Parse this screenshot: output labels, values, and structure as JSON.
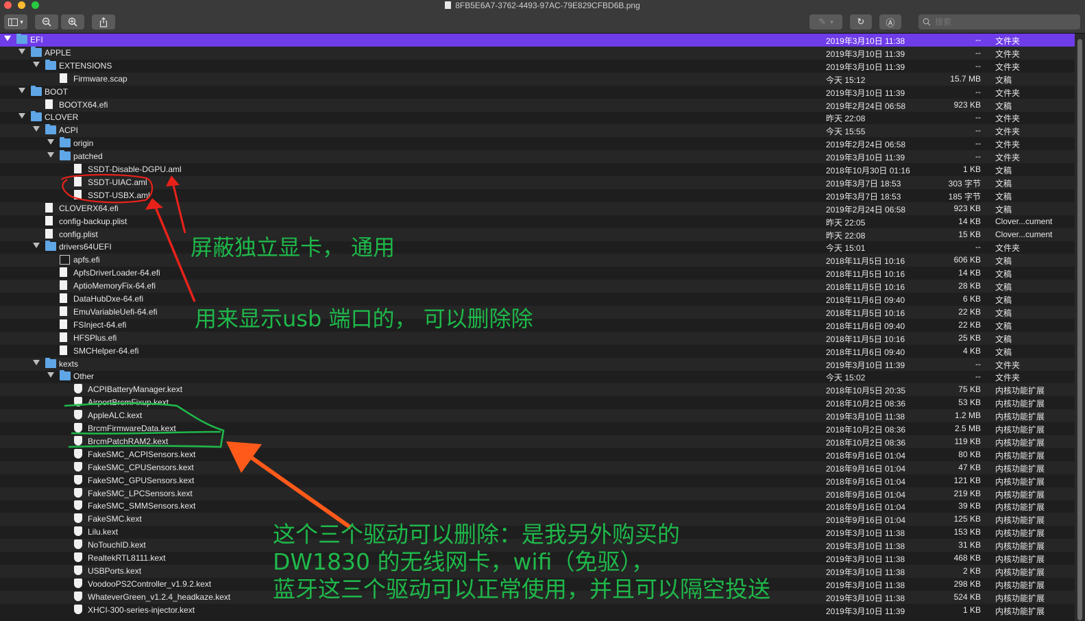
{
  "window": {
    "title": "8FB5E6A7-3762-4493-97AC-79E829CFBD6B.png",
    "lights": [
      "#ff5f57",
      "#febc2e",
      "#28c840"
    ]
  },
  "toolbar": {
    "sidebar_icon": "sidebar-icon",
    "chevron": "▾",
    "zoom_out": "⊖",
    "zoom_in": "⊕",
    "share": "⇪",
    "markup": "✎",
    "rotate": "↻",
    "annotate": "Ⓐ",
    "search_placeholder": "搜索"
  },
  "colors": {
    "selection": "#6e3ce8",
    "folder": "#5fa6e6",
    "annotation_green": "#1fb84a",
    "annotation_red": "#e8221a",
    "annotation_orange": "#ff5a1a"
  },
  "rows": [
    {
      "name": "EFI",
      "depth": 0,
      "type": "folder",
      "expanded": true,
      "date": "2019年3月10日 11:38",
      "size": "--",
      "kind": "文件夹",
      "selected": true
    },
    {
      "name": "APPLE",
      "depth": 1,
      "type": "folder",
      "expanded": true,
      "date": "2019年3月10日 11:39",
      "size": "--",
      "kind": "文件夹"
    },
    {
      "name": "EXTENSIONS",
      "depth": 2,
      "type": "folder",
      "expanded": true,
      "date": "2019年3月10日 11:39",
      "size": "--",
      "kind": "文件夹"
    },
    {
      "name": "Firmware.scap",
      "depth": 3,
      "type": "file",
      "date": "今天 15:12",
      "size": "15.7 MB",
      "kind": "文稿"
    },
    {
      "name": "BOOT",
      "depth": 1,
      "type": "folder",
      "expanded": true,
      "date": "2019年3月10日 11:39",
      "size": "--",
      "kind": "文件夹"
    },
    {
      "name": "BOOTX64.efi",
      "depth": 2,
      "type": "file",
      "date": "2019年2月24日 06:58",
      "size": "923 KB",
      "kind": "文稿"
    },
    {
      "name": "CLOVER",
      "depth": 1,
      "type": "folder",
      "expanded": true,
      "date": "昨天 22:08",
      "size": "--",
      "kind": "文件夹"
    },
    {
      "name": "ACPI",
      "depth": 2,
      "type": "folder",
      "expanded": true,
      "date": "今天 15:55",
      "size": "--",
      "kind": "文件夹"
    },
    {
      "name": "origin",
      "depth": 3,
      "type": "folder",
      "expanded": true,
      "date": "2019年2月24日 06:58",
      "size": "--",
      "kind": "文件夹"
    },
    {
      "name": "patched",
      "depth": 3,
      "type": "folder",
      "expanded": true,
      "date": "2019年3月10日 11:39",
      "size": "--",
      "kind": "文件夹"
    },
    {
      "name": "SSDT-Disable-DGPU.aml",
      "depth": 4,
      "type": "file",
      "date": "2018年10月30日 01:16",
      "size": "1 KB",
      "kind": "文稿"
    },
    {
      "name": "SSDT-UIAC.aml",
      "depth": 4,
      "type": "file",
      "date": "2019年3月7日 18:53",
      "size": "303 字节",
      "kind": "文稿"
    },
    {
      "name": "SSDT-USBX.aml",
      "depth": 4,
      "type": "file",
      "date": "2019年3月7日 18:53",
      "size": "185 字节",
      "kind": "文稿"
    },
    {
      "name": "CLOVERX64.efi",
      "depth": 2,
      "type": "file",
      "date": "2019年2月24日 06:58",
      "size": "923 KB",
      "kind": "文稿"
    },
    {
      "name": "config-backup.plist",
      "depth": 2,
      "type": "file",
      "date": "昨天 22:05",
      "size": "14 KB",
      "kind": "Clover...cument"
    },
    {
      "name": "config.plist",
      "depth": 2,
      "type": "file",
      "date": "昨天 22:08",
      "size": "15 KB",
      "kind": "Clover...cument"
    },
    {
      "name": "drivers64UEFI",
      "depth": 2,
      "type": "folder",
      "expanded": true,
      "date": "今天 15:01",
      "size": "--",
      "kind": "文件夹"
    },
    {
      "name": "apfs.efi",
      "depth": 3,
      "type": "efi",
      "date": "2018年11月5日 10:16",
      "size": "606 KB",
      "kind": "文稿"
    },
    {
      "name": "ApfsDriverLoader-64.efi",
      "depth": 3,
      "type": "file",
      "date": "2018年11月5日 10:16",
      "size": "14 KB",
      "kind": "文稿"
    },
    {
      "name": "AptioMemoryFix-64.efi",
      "depth": 3,
      "type": "file",
      "date": "2018年11月5日 10:16",
      "size": "28 KB",
      "kind": "文稿"
    },
    {
      "name": "DataHubDxe-64.efi",
      "depth": 3,
      "type": "file",
      "date": "2018年11月6日 09:40",
      "size": "6 KB",
      "kind": "文稿"
    },
    {
      "name": "EmuVariableUefi-64.efi",
      "depth": 3,
      "type": "file",
      "date": "2018年11月5日 10:16",
      "size": "22 KB",
      "kind": "文稿"
    },
    {
      "name": "FSInject-64.efi",
      "depth": 3,
      "type": "file",
      "date": "2018年11月6日 09:40",
      "size": "22 KB",
      "kind": "文稿"
    },
    {
      "name": "HFSPlus.efi",
      "depth": 3,
      "type": "file",
      "date": "2018年11月5日 10:16",
      "size": "25 KB",
      "kind": "文稿"
    },
    {
      "name": "SMCHelper-64.efi",
      "depth": 3,
      "type": "file",
      "date": "2018年11月6日 09:40",
      "size": "4 KB",
      "kind": "文稿"
    },
    {
      "name": "kexts",
      "depth": 2,
      "type": "folder",
      "expanded": true,
      "date": "2019年3月10日 11:39",
      "size": "--",
      "kind": "文件夹"
    },
    {
      "name": "Other",
      "depth": 3,
      "type": "folder",
      "expanded": true,
      "date": "今天 15:02",
      "size": "--",
      "kind": "文件夹"
    },
    {
      "name": "ACPIBatteryManager.kext",
      "depth": 4,
      "type": "kext",
      "date": "2018年10月5日 20:35",
      "size": "75 KB",
      "kind": "内核功能扩展"
    },
    {
      "name": "AirportBrcmFixup.kext",
      "depth": 4,
      "type": "kext",
      "date": "2018年10月2日 08:36",
      "size": "53 KB",
      "kind": "内核功能扩展"
    },
    {
      "name": "AppleALC.kext",
      "depth": 4,
      "type": "kext",
      "date": "2019年3月10日 11:38",
      "size": "1.2 MB",
      "kind": "内核功能扩展"
    },
    {
      "name": "BrcmFirmwareData.kext",
      "depth": 4,
      "type": "kext",
      "date": "2018年10月2日 08:36",
      "size": "2.5 MB",
      "kind": "内核功能扩展"
    },
    {
      "name": "BrcmPatchRAM2.kext",
      "depth": 4,
      "type": "kext",
      "date": "2018年10月2日 08:36",
      "size": "119 KB",
      "kind": "内核功能扩展"
    },
    {
      "name": "FakeSMC_ACPISensors.kext",
      "depth": 4,
      "type": "kext",
      "date": "2018年9月16日 01:04",
      "size": "80 KB",
      "kind": "内核功能扩展"
    },
    {
      "name": "FakeSMC_CPUSensors.kext",
      "depth": 4,
      "type": "kext",
      "date": "2018年9月16日 01:04",
      "size": "47 KB",
      "kind": "内核功能扩展"
    },
    {
      "name": "FakeSMC_GPUSensors.kext",
      "depth": 4,
      "type": "kext",
      "date": "2018年9月16日 01:04",
      "size": "121 KB",
      "kind": "内核功能扩展"
    },
    {
      "name": "FakeSMC_LPCSensors.kext",
      "depth": 4,
      "type": "kext",
      "date": "2018年9月16日 01:04",
      "size": "219 KB",
      "kind": "内核功能扩展"
    },
    {
      "name": "FakeSMC_SMMSensors.kext",
      "depth": 4,
      "type": "kext",
      "date": "2018年9月16日 01:04",
      "size": "39 KB",
      "kind": "内核功能扩展"
    },
    {
      "name": "FakeSMC.kext",
      "depth": 4,
      "type": "kext",
      "date": "2018年9月16日 01:04",
      "size": "125 KB",
      "kind": "内核功能扩展"
    },
    {
      "name": "Lilu.kext",
      "depth": 4,
      "type": "kext",
      "date": "2019年3月10日 11:38",
      "size": "153 KB",
      "kind": "内核功能扩展"
    },
    {
      "name": "NoTouchID.kext",
      "depth": 4,
      "type": "kext",
      "date": "2019年3月10日 11:38",
      "size": "31 KB",
      "kind": "内核功能扩展"
    },
    {
      "name": "RealtekRTL8111.kext",
      "depth": 4,
      "type": "kext",
      "date": "2019年3月10日 11:38",
      "size": "468 KB",
      "kind": "内核功能扩展"
    },
    {
      "name": "USBPorts.kext",
      "depth": 4,
      "type": "kext",
      "date": "2019年3月10日 11:38",
      "size": "2 KB",
      "kind": "内核功能扩展"
    },
    {
      "name": "VoodooPS2Controller_v1.9.2.kext",
      "depth": 4,
      "type": "kext",
      "date": "2019年3月10日 11:38",
      "size": "298 KB",
      "kind": "内核功能扩展"
    },
    {
      "name": "WhateverGreen_v1.2.4_headkaze.kext",
      "depth": 4,
      "type": "kext",
      "date": "2019年3月10日 11:38",
      "size": "524 KB",
      "kind": "内核功能扩展"
    },
    {
      "name": "XHCI-300-series-injector.kext",
      "depth": 4,
      "type": "kext",
      "date": "2019年3月10日 11:39",
      "size": "1 KB",
      "kind": "内核功能扩展"
    }
  ],
  "annotations": {
    "note1": "屏蔽独立显卡， 通用",
    "note2": "用来显示usb 端口的， 可以删除除",
    "note3": {
      "line1": "这个三个驱动可以删除：是我另外购买的",
      "line2": "DW1830 的无线网卡，wifi（免驱），",
      "line3": "蓝牙这三个驱动可以正常使用，并且可以隔空投送"
    }
  }
}
